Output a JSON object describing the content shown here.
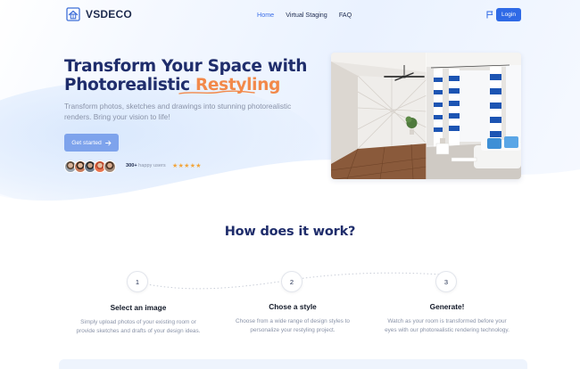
{
  "brand": {
    "name": "VSDECO"
  },
  "nav": {
    "items": [
      {
        "label": "Home",
        "active": true
      },
      {
        "label": "Virtual Staging",
        "active": false
      },
      {
        "label": "FAQ",
        "active": false
      }
    ],
    "login_label": "Login"
  },
  "hero": {
    "title_line1": "Transform Your Space with",
    "title_line2_prefix": "Photorealistic ",
    "title_line2_accent": "Restyling",
    "subtitle": "Transform photos, sketches and drawings into stunning photorealistic renders. Bring your vision to life!",
    "cta_label": "Get started",
    "happy_count": "300+",
    "happy_text": "happy users",
    "stars": "★★★★★",
    "rating": 5
  },
  "how": {
    "title": "How does it work?",
    "steps": [
      {
        "number": "1",
        "title": "Select an image",
        "desc_line1": "Simply upload photos of your existing room or",
        "desc_line2": "provide sketches and drafts of your design ideas."
      },
      {
        "number": "2",
        "title": "Chose a style",
        "desc_line1": "Choose from a wide range of design styles to",
        "desc_line2": "personalize your restyling project."
      },
      {
        "number": "3",
        "title": "Generate!",
        "desc_line1": "Watch as your room is transformed before your",
        "desc_line2": "eyes with our photorealistic rendering technology."
      }
    ]
  },
  "colors": {
    "primary": "#2f6ae6",
    "title": "#1f2d6b",
    "accent": "#f2894a",
    "star": "#f2a53a",
    "muted": "#8a93a8"
  },
  "icons": {
    "logo": "house-logo-icon",
    "language": "flag-icon",
    "cta_arrow": "arrow-right-icon"
  }
}
